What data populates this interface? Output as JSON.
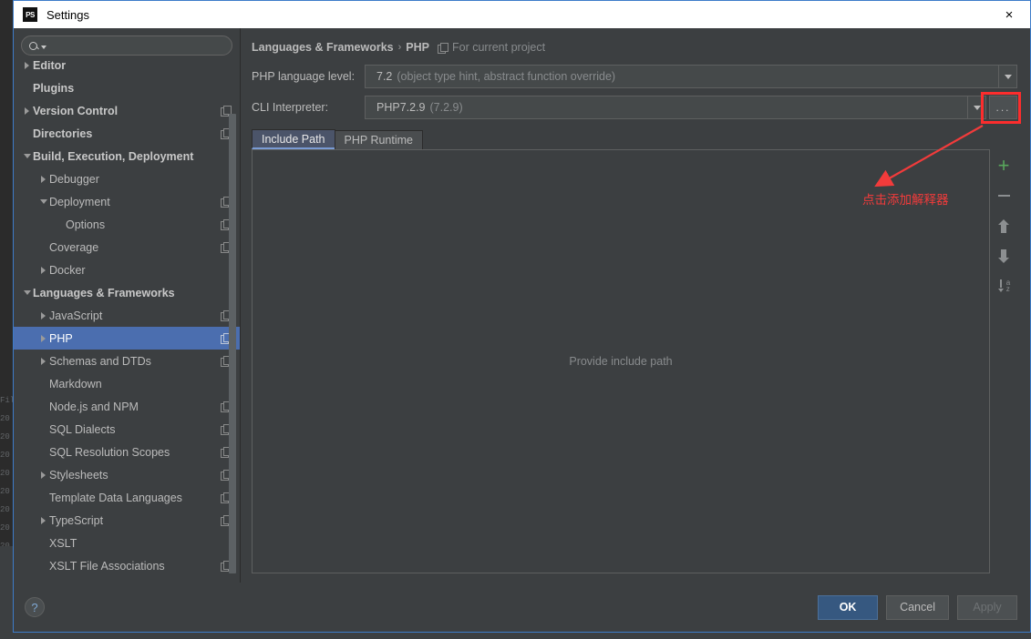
{
  "window": {
    "title": "Settings",
    "app_icon": "PS",
    "close_icon": "×"
  },
  "sidebar": {
    "search": {
      "placeholder": "",
      "value": "",
      "icon": "search-icon"
    },
    "items": [
      {
        "label": "Editor",
        "indent": 0,
        "toggle": "right",
        "bold": true,
        "module": false,
        "selected": false,
        "clipped": true
      },
      {
        "label": "Plugins",
        "indent": 0,
        "toggle": "none",
        "bold": true,
        "module": false,
        "selected": false
      },
      {
        "label": "Version Control",
        "indent": 0,
        "toggle": "right",
        "bold": true,
        "module": true,
        "selected": false
      },
      {
        "label": "Directories",
        "indent": 0,
        "toggle": "none",
        "bold": true,
        "module": true,
        "selected": false
      },
      {
        "label": "Build, Execution, Deployment",
        "indent": 0,
        "toggle": "down",
        "bold": true,
        "module": false,
        "selected": false
      },
      {
        "label": "Debugger",
        "indent": 1,
        "toggle": "right",
        "bold": false,
        "module": false,
        "selected": false
      },
      {
        "label": "Deployment",
        "indent": 1,
        "toggle": "down",
        "bold": false,
        "module": true,
        "selected": false
      },
      {
        "label": "Options",
        "indent": 2,
        "toggle": "none",
        "bold": false,
        "module": true,
        "selected": false
      },
      {
        "label": "Coverage",
        "indent": 1,
        "toggle": "none",
        "bold": false,
        "module": true,
        "selected": false
      },
      {
        "label": "Docker",
        "indent": 1,
        "toggle": "right",
        "bold": false,
        "module": false,
        "selected": false
      },
      {
        "label": "Languages & Frameworks",
        "indent": 0,
        "toggle": "down",
        "bold": true,
        "module": false,
        "selected": false
      },
      {
        "label": "JavaScript",
        "indent": 1,
        "toggle": "right",
        "bold": false,
        "module": true,
        "selected": false
      },
      {
        "label": "PHP",
        "indent": 1,
        "toggle": "right",
        "bold": false,
        "module": true,
        "selected": true
      },
      {
        "label": "Schemas and DTDs",
        "indent": 1,
        "toggle": "right",
        "bold": false,
        "module": true,
        "selected": false
      },
      {
        "label": "Markdown",
        "indent": 1,
        "toggle": "none",
        "bold": false,
        "module": false,
        "selected": false
      },
      {
        "label": "Node.js and NPM",
        "indent": 1,
        "toggle": "none",
        "bold": false,
        "module": true,
        "selected": false
      },
      {
        "label": "SQL Dialects",
        "indent": 1,
        "toggle": "none",
        "bold": false,
        "module": true,
        "selected": false
      },
      {
        "label": "SQL Resolution Scopes",
        "indent": 1,
        "toggle": "none",
        "bold": false,
        "module": true,
        "selected": false
      },
      {
        "label": "Stylesheets",
        "indent": 1,
        "toggle": "right",
        "bold": false,
        "module": true,
        "selected": false
      },
      {
        "label": "Template Data Languages",
        "indent": 1,
        "toggle": "none",
        "bold": false,
        "module": true,
        "selected": false
      },
      {
        "label": "TypeScript",
        "indent": 1,
        "toggle": "right",
        "bold": false,
        "module": true,
        "selected": false
      },
      {
        "label": "XSLT",
        "indent": 1,
        "toggle": "none",
        "bold": false,
        "module": false,
        "selected": false
      },
      {
        "label": "XSLT File Associations",
        "indent": 1,
        "toggle": "none",
        "bold": false,
        "module": true,
        "selected": false
      }
    ]
  },
  "content": {
    "breadcrumb": {
      "root": "Languages & Frameworks",
      "separator": "›",
      "leaf": "PHP",
      "scope_icon": "module-icon",
      "scope_label": "For current project"
    },
    "language_level": {
      "label": "PHP language level:",
      "value_strong": "7.2",
      "value_dim": "(object type hint, abstract function override)"
    },
    "cli_interpreter": {
      "label": "CLI Interpreter:",
      "value_strong": "PHP7.2.9",
      "value_dim": "(7.2.9)",
      "browse_label": "..."
    },
    "tabs": [
      {
        "label": "Include Path",
        "active": true
      },
      {
        "label": "PHP Runtime",
        "active": false
      }
    ],
    "empty_text": "Provide include path",
    "toolbar": [
      {
        "icon": "add-icon",
        "glyph": "+"
      },
      {
        "icon": "remove-icon",
        "glyph": "−"
      },
      {
        "icon": "move-up-icon",
        "glyph": "↑"
      },
      {
        "icon": "move-down-icon",
        "glyph": "↓"
      },
      {
        "icon": "sort-az-icon",
        "glyph": "↓az"
      }
    ]
  },
  "annotation": {
    "text": "点击添加解释器",
    "color": "#f23b3b",
    "highlight_color": "#fc2d2d"
  },
  "footer": {
    "help_label": "?",
    "ok_label": "OK",
    "cancel_label": "Cancel",
    "apply_label": "Apply"
  },
  "colors": {
    "accent_selection": "#4b6eaf",
    "primary_button": "#365880",
    "panel_bg": "#3c3f41",
    "add_icon_green": "#58a65c",
    "annotation_red": "#f23b3b"
  }
}
